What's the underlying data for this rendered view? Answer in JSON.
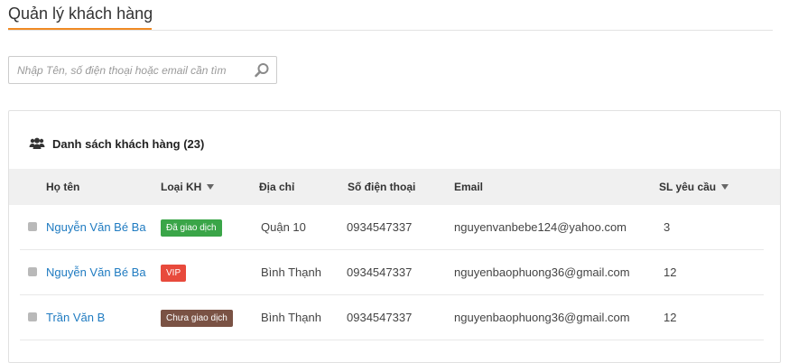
{
  "page": {
    "title": "Quản lý khách hàng"
  },
  "search": {
    "placeholder": "Nhập Tên, số điện thoại hoặc email cần tìm"
  },
  "panel": {
    "title": "Danh sách khách hàng (23)"
  },
  "table": {
    "columns": {
      "name": "Họ tên",
      "type": "Loại KH",
      "address": "Địa chỉ",
      "phone": "Số điện thoại",
      "email": "Email",
      "requests": "SL yêu cầu"
    },
    "rows": [
      {
        "name": "Nguyễn Văn Bé Ba",
        "type": "Đã giao dịch",
        "type_color": "#3aa548",
        "address": "Quận 10",
        "phone": "0934547337",
        "email": "nguyenvanbebe124@yahoo.com",
        "requests": "3"
      },
      {
        "name": "Nguyễn Văn Bé Ba",
        "type": "VIP",
        "type_color": "#e84a3c",
        "address": "Bình Thạnh",
        "phone": "0934547337",
        "email": "nguyenbaophuong36@gmail.com",
        "requests": "12"
      },
      {
        "name": "Trần Văn B",
        "type": "Chưa giao dịch",
        "type_color": "#7a5244",
        "address": "Bình Thạnh",
        "phone": "0934547337",
        "email": "nguyenbaophuong36@gmail.com",
        "requests": "12"
      }
    ]
  },
  "colors": {
    "accent": "#f08a24",
    "link": "#1f7bc1"
  }
}
